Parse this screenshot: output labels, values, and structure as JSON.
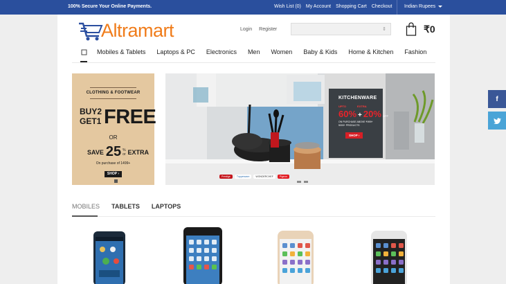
{
  "topbar": {
    "secure_text": "100% Secure Your Online Payments.",
    "links": [
      "Wish List (0)",
      "My Account",
      "Shopping Cart",
      "Checkout"
    ],
    "currency": "Indian Rupees",
    "bg_color": "#2a4f9d"
  },
  "header": {
    "logo_text": "Altramart",
    "logo_color": "#f07c1a",
    "login": "Login",
    "register": "Register",
    "search_placeholder": "",
    "cart_total": "₹0"
  },
  "nav": {
    "home_icon": "home-icon",
    "items": [
      "Mobiles & Tablets",
      "Laptops & PC",
      "Electronics",
      "Men",
      "Women",
      "Baby & Kids",
      "Home & Kitchen",
      "Fashion"
    ]
  },
  "banner_left": {
    "title": "CLOTHING & FOOTWEAR",
    "buy_line1": "BUY2",
    "buy_line2": "GET1",
    "free": "FREE",
    "or": "OR",
    "save": "SAVE",
    "percent": "25",
    "pct_sign": "%",
    "or_small": "or",
    "extra": "EXTRA",
    "purchase_note": "On purchase of 1499+",
    "shop": "SHOP"
  },
  "banner_main": {
    "heading": "KITCHENWARE",
    "upto": "UPTO",
    "extra": "EXTRA",
    "discount1": "60%",
    "plus": "+",
    "discount2": "20%",
    "off": "OFF",
    "cond_line1": "ON PURCHASE ABOVE ₹999+",
    "cond_line2": "5000+ PRODUCTS",
    "shop": "SHOP",
    "brands": [
      "Prestige",
      "Tupperware",
      "WONDERCHEF",
      "Pigeon"
    ]
  },
  "product_tabs": [
    "MOBILES",
    "TABLETS",
    "LAPTOPS"
  ],
  "products": [
    "android-phone",
    "iphone-black",
    "iphone-gold",
    "iphone-silver"
  ],
  "social": [
    "facebook-icon",
    "twitter-icon"
  ]
}
